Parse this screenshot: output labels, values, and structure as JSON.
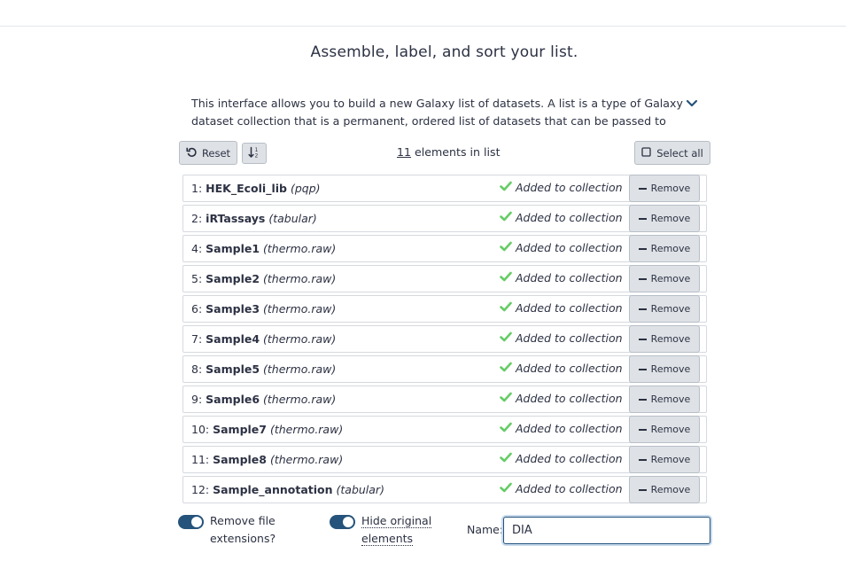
{
  "heading": "Assemble, label, and sort your list.",
  "intro": {
    "text": "This interface allows you to build a new Galaxy list of datasets. A list is a type of Galaxy dataset collection that is a permanent, ordered list of datasets that can be passed to tools"
  },
  "toolbar": {
    "reset_label": "Reset",
    "count_number": "11",
    "count_suffix": " elements in list",
    "select_all_label": "Select all"
  },
  "elements": [
    {
      "index": "1:",
      "name": "HEK_Ecoli_lib",
      "ext": "(pqp)",
      "status": "Added to collection",
      "remove_label": "Remove"
    },
    {
      "index": "2:",
      "name": "iRTassays",
      "ext": "(tabular)",
      "status": "Added to collection",
      "remove_label": "Remove"
    },
    {
      "index": "4:",
      "name": "Sample1",
      "ext": "(thermo.raw)",
      "status": "Added to collection",
      "remove_label": "Remove"
    },
    {
      "index": "5:",
      "name": "Sample2",
      "ext": "(thermo.raw)",
      "status": "Added to collection",
      "remove_label": "Remove"
    },
    {
      "index": "6:",
      "name": "Sample3",
      "ext": "(thermo.raw)",
      "status": "Added to collection",
      "remove_label": "Remove"
    },
    {
      "index": "7:",
      "name": "Sample4",
      "ext": "(thermo.raw)",
      "status": "Added to collection",
      "remove_label": "Remove"
    },
    {
      "index": "8:",
      "name": "Sample5",
      "ext": "(thermo.raw)",
      "status": "Added to collection",
      "remove_label": "Remove"
    },
    {
      "index": "9:",
      "name": "Sample6",
      "ext": "(thermo.raw)",
      "status": "Added to collection",
      "remove_label": "Remove"
    },
    {
      "index": "10:",
      "name": "Sample7",
      "ext": "(thermo.raw)",
      "status": "Added to collection",
      "remove_label": "Remove"
    },
    {
      "index": "11:",
      "name": "Sample8",
      "ext": "(thermo.raw)",
      "status": "Added to collection",
      "remove_label": "Remove"
    },
    {
      "index": "12:",
      "name": "Sample_annotation",
      "ext": "(tabular)",
      "status": "Added to collection",
      "remove_label": "Remove"
    }
  ],
  "options": {
    "remove_extensions_label": "Remove file extensions?",
    "remove_extensions_on": true,
    "hide_original_label": "Hide original elements",
    "hide_original_on": true
  },
  "name_field": {
    "label": "Name:",
    "value": "DIA"
  },
  "colors": {
    "accent": "#25537b",
    "success": "#66cc66",
    "button_bg": "#dee2e6"
  }
}
